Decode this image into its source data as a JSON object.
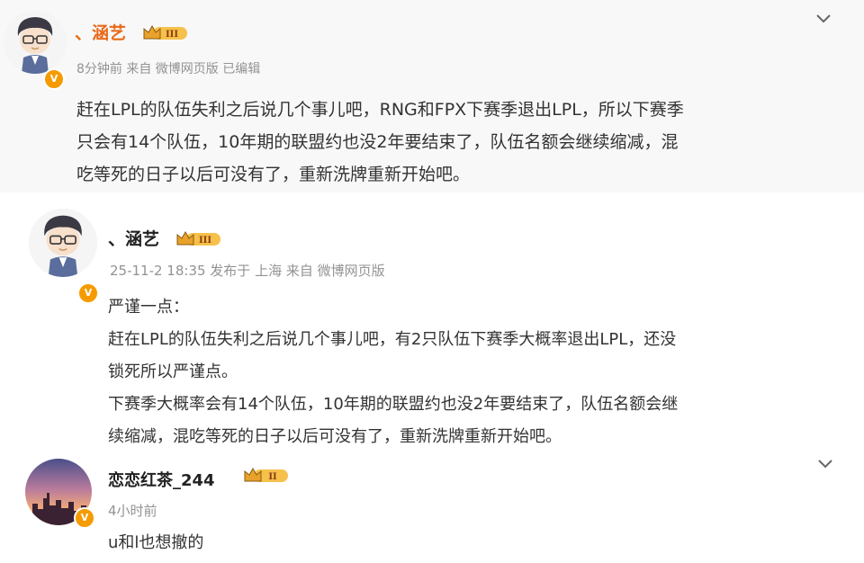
{
  "posts": [
    {
      "username": "、涵艺",
      "level": "III",
      "meta": "8分钟前  来自 微博网页版 已编辑",
      "lines": [
        "赶在LPL的队伍失利之后说几个事儿吧，RNG和FPX下赛季退出LPL，所以下赛季",
        "只会有14个队伍，10年期的联盟约也没2年要结束了，队伍名额会继续缩减，混",
        "吃等死的日子以后可没有了，重新洗牌重新开始吧。"
      ]
    },
    {
      "username": "、涵艺",
      "level": "III",
      "meta": "25-11-2 18:35 发布于 上海  来自 微博网页版",
      "lines": [
        "严谨一点：",
        "赶在LPL的队伍失利之后说几个事儿吧，有2只队伍下赛季大概率退出LPL，还没",
        "锁死所以严谨点。",
        "下赛季大概率会有14个队伍，10年期的联盟约也没2年要结束了，队伍名额会继",
        "续缩减，混吃等死的日子以后可没有了，重新洗牌重新开始吧。"
      ]
    },
    {
      "username": "恋恋红茶_244",
      "level": "II",
      "meta": "4小时前",
      "lines": [
        "u和l也想撤的"
      ]
    }
  ],
  "verified_badge": "V",
  "colors": {
    "name_orange": "#e86a18",
    "meta_gray": "#939393",
    "level_gold": "#e8a22a",
    "verified": "#f59b00"
  },
  "icons": {
    "menu": "chevron-down-icon",
    "level": "crown-level-badge"
  }
}
